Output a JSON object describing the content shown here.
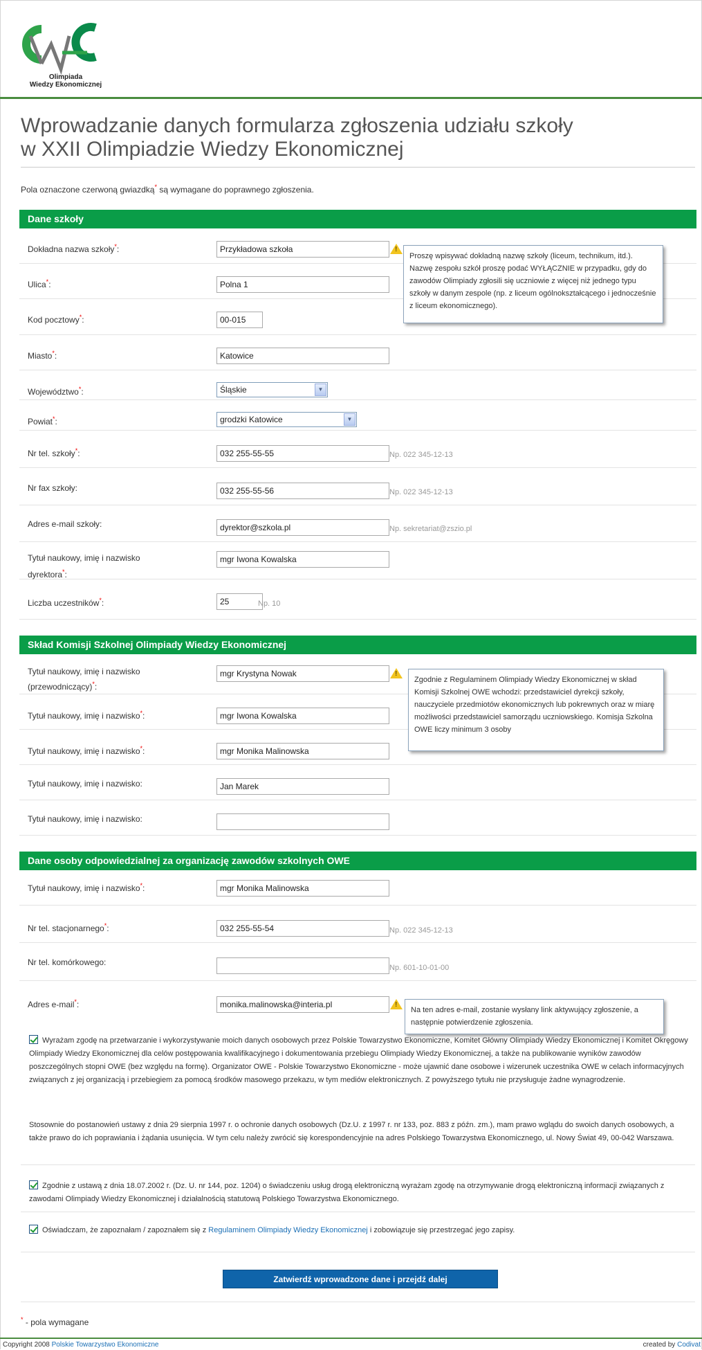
{
  "brand": {
    "logo_text_1": "Olimpiada",
    "logo_text_2": "Wiedzy Ekonomicznej",
    "green": "#0a9d48",
    "blue": "#0f64aa"
  },
  "page_title_1": "Wprowadzanie danych formularza zgłoszenia udziału szkoły",
  "page_title_2": "w XXII Olimpiadzie Wiedzy Ekonomicznej",
  "intro_before": "Pola oznaczone czerwoną gwiazdką",
  "intro_after": "są wymagane do poprawnego zgłoszenia.",
  "star": "*",
  "school": {
    "header": "Dane szkoły",
    "name_label": "Dokładna nazwa szkoły",
    "name_value": "Przykładowa szkoła",
    "street_label": "Ulica",
    "street_value": "Polna 1",
    "zip_label": "Kod pocztowy",
    "zip_value": "00-015",
    "city_label": "Miasto",
    "city_value": "Katowice",
    "province_label": "Województwo",
    "province_value": "Śląskie",
    "county_label": "Powiat",
    "county_value": "grodzki Katowice",
    "phone_label": "Nr tel. szkoły",
    "phone_value": "032 255-55-55",
    "phone_hint": "Np. 022 345-12-13",
    "fax_label": "Nr fax szkoły:",
    "fax_value": "032 255-55-56",
    "fax_hint": "Np. 022 345-12-13",
    "email_label": "Adres e-mail szkoły:",
    "email_value": "dyrektor@szkola.pl",
    "email_hint": "Np. sekretariat@zszio.pl",
    "director_label_1": "Tytuł naukowy, imię i nazwisko",
    "director_label_2": "dyrektora",
    "director_value": "mgr Iwona Kowalska",
    "count_label": "Liczba uczestników",
    "count_value": "25",
    "count_hint": "Np. 10",
    "tooltip": "Proszę wpisywać dokładną nazwę szkoły (liceum, technikum, itd.). Nazwę zespołu szkół proszę podać WYŁĄCZNIE w przypadku, gdy do zawodów Olimpiady zgłosili się uczniowie z więcej niż jednego typu szkoły w danym zespole (np. z liceum ogólnokształcącego i jednocześnie z liceum ekonomicznego)."
  },
  "committee": {
    "header": "Skład Komisji Szkolnej Olimpiady Wiedzy Ekonomicznej",
    "chair_label_1": "Tytuł naukowy, imię i nazwisko",
    "chair_label_2": "(przewodniczący)",
    "chair_value": "mgr Krystyna Nowak",
    "member_label": "Tytuł naukowy, imię i nazwisko",
    "member_label_plain": "Tytuł naukowy, imię i nazwisko:",
    "m1_value": "mgr Iwona Kowalska",
    "m2_value": "mgr Monika Malinowska",
    "m3_value": "Jan Marek",
    "m4_value": "",
    "tooltip": "Zgodnie z Regulaminem Olimpiady Wiedzy Ekonomicznej w skład Komisji Szkolnej OWE wchodzi: przedstawiciel dyrekcji szkoły, nauczyciele przedmiotów ekonomicznych lub pokrewnych oraz w miarę możliwości przedstawiciel samorządu uczniowskiego. Komisja Szkolna OWE liczy minimum 3 osoby"
  },
  "contact": {
    "header": "Dane osoby odpowiedzialnej za organizację zawodów szkolnych OWE",
    "name_label": "Tytuł naukowy, imię i nazwisko",
    "name_value": "mgr Monika Malinowska",
    "phone_label": "Nr tel. stacjonarnego",
    "phone_value": "032 255-55-54",
    "phone_hint": "Np. 022 345-12-13",
    "mobile_label": "Nr tel. komórkowego:",
    "mobile_value": "",
    "mobile_hint": "Np. 601-10-01-00",
    "email_label": "Adres e-mail",
    "email_value": "monika.malinowska@interia.pl",
    "email_hint": "N",
    "tooltip": "Na ten adres e-mail, zostanie wysłany link aktywujący zgłoszenie, a następnie potwierdzenie zgłoszenia."
  },
  "consent1": "Wyrażam zgodę na przetwarzanie i wykorzystywanie moich danych osobowych przez Polskie Towarzystwo Ekonomiczne, Komitet Główny Olimpiady Wiedzy Ekonomicznej i Komitet Okręgowy Olimpiady Wiedzy Ekonomicznej dla celów postępowania kwalifikacyjnego i dokumentowania przebiegu Olimpiady Wiedzy Ekonomicznej, a także na publikowanie wyników zawodów poszczególnych stopni OWE (bez względu na formę). Organizator OWE - Polskie Towarzystwo Ekonomiczne - może ujawnić dane osobowe i wizerunek uczestnika OWE w celach informacyjnych związanych z jej organizacją i przebiegiem za pomocą środków masowego przekazu, w tym mediów elektronicznych. Z powyższego tytułu nie przysługuje żadne wynagrodzenie.",
  "law_note": "Stosownie do postanowień ustawy z dnia 29 sierpnia 1997 r. o ochronie danych osobowych (Dz.U. z 1997 r. nr 133, poz. 883 z późn. zm.), mam prawo wglądu do swoich danych osobowych, a także prawo do ich poprawiania i żądania usunięcia. W tym celu należy zwrócić się korespondencyjnie na adres Polskiego Towarzystwa Ekonomicznego, ul. Nowy Świat 49, 00-042 Warszawa.",
  "consent2": "Zgodnie z ustawą z dnia 18.07.2002 r. (Dz. U. nr 144, poz. 1204) o świadczeniu usług drogą elektroniczną wyrażam zgodę na otrzymywanie drogą elektroniczną informacji związanych z zawodami Olimpiady Wiedzy Ekonomicznej i działalnością statutową Polskiego Towarzystwa Ekonomicznego.",
  "consent3_before": "Oświadczam, że zapoznałam / zapoznałem się z",
  "consent3_link": "Regulaminem Olimpiady Wiedzy Ekonomicznej",
  "consent3_after": "i zobowiązuje się przestrzegać jego zapisy.",
  "submit_label": "Zatwierdź wprowadzone dane i przejdź dalej",
  "footnote": "- pola wymagane",
  "footer_left_prefix": "Copyright 2008",
  "footer_left_link": "Polskie Towarzystwo Ekonomiczne",
  "footer_right_prefix": "created by",
  "footer_right_link": "Codivat"
}
